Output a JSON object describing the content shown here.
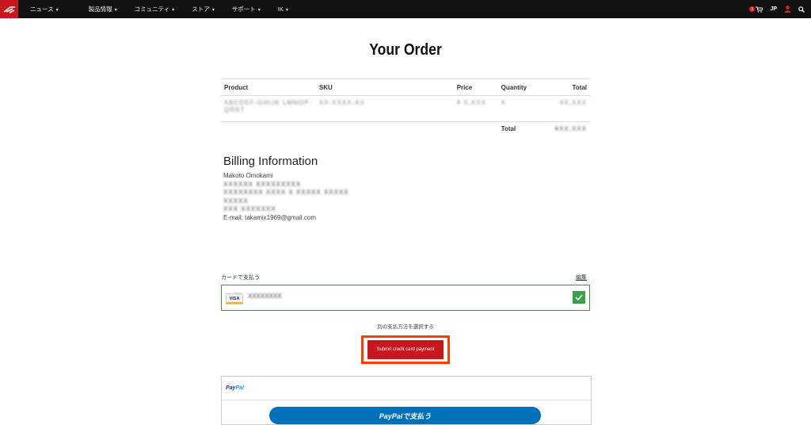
{
  "nav": {
    "items": [
      {
        "label": "ニュース"
      },
      {
        "label": "製品情報"
      },
      {
        "label": "コミュニティ"
      },
      {
        "label": "ストア"
      },
      {
        "label": "サポート"
      },
      {
        "label": "IK"
      }
    ],
    "lang": "JP",
    "cart_count": "1"
  },
  "page": {
    "title": "Your Order"
  },
  "order": {
    "headers": {
      "product": "Product",
      "sku": "SKU",
      "price": "Price",
      "quantity": "Quantity",
      "total": "Total"
    },
    "row": {
      "product": "ABCDEF-GHIJK LMNOP-QRST",
      "sku": "XX-XXXX-XX",
      "price": "¥ X,XXX",
      "quantity": "X",
      "total": "¥X,XXX"
    },
    "total_label": "Total",
    "total_value": "¥XX,XXX"
  },
  "billing": {
    "title": "Billing Information",
    "name": "Makoto Omokami",
    "line1": "XXXXXX XXXXXXXXX",
    "line2": "XXXXXXXX XXXX   X  XXXXX XXXXX",
    "line3": "XXXXX",
    "line4": "XXX XXXXXXX",
    "email": "E-mail: takamix1969@gmail.com"
  },
  "payment": {
    "card_label": "カードで支払う",
    "edit_label": "編集",
    "card_brand": "VISA",
    "card_number": "XXXXXXXX",
    "alt_label": "別の支払方法を選択する",
    "submit_label": "Submit credit card payment",
    "paypal_logo_a": "Pay",
    "paypal_logo_b": "Pal",
    "paypal_button": "PayPalで支払う"
  },
  "colors": {
    "brand_red": "#c8161d",
    "highlight": "#ff3b00",
    "check_green": "#3aa04a",
    "paypal_blue": "#0070ba"
  }
}
